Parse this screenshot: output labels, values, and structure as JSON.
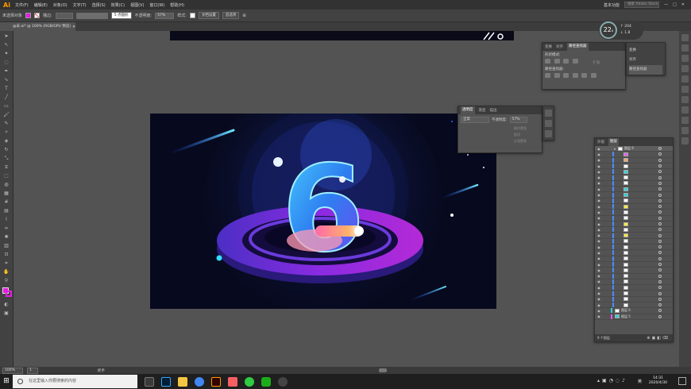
{
  "app": {
    "logo": "Ai",
    "menu": [
      "文件(F)",
      "编辑(E)",
      "对象(O)",
      "文字(T)",
      "选择(S)",
      "效果(C)",
      "视图(V)",
      "窗口(W)",
      "帮助(H)"
    ],
    "workspace": "基本功能",
    "search_placeholder": "搜索 Adobe Stock"
  },
  "control_bar": {
    "selection": "未选择对象",
    "stroke_label": "描边:",
    "stroke_style": "5 点圆形",
    "opacity_label": "不透明度:",
    "opacity": "57%",
    "style_label": "样式:",
    "doc_setup": "文档设置",
    "preferences": "首选项"
  },
  "document": {
    "tab": "@未.ai* @ 100% (RGB/GPU 预览)"
  },
  "pathfinder": {
    "tabs": [
      "变换",
      "对齐",
      "路径查找器"
    ],
    "shape_modes": "形状模式:",
    "pathfinders": "路径查找器:",
    "expand": "扩展"
  },
  "transparency": {
    "tabs": [
      "透明度",
      "渐变",
      "描边"
    ],
    "mode": "正常",
    "opacity_label": "不透明度:",
    "opacity": "57%",
    "opts": [
      "制作蒙版",
      "剪切",
      "反相蒙版"
    ]
  },
  "mini_dock": {
    "items": [
      "变换",
      "对齐",
      "路径查找器"
    ]
  },
  "layers": {
    "tabs": [
      "外观",
      "图层"
    ],
    "layer_top": "图层 9",
    "layer_bottom1": "图层 6",
    "layer_bottom2": "图层 5",
    "count": "9 个图层",
    "row_colors": [
      "#e05de8",
      "#f0a96a",
      "#ffffff",
      "#2fd4d6",
      "#ffffff",
      "#ffffff",
      "#2fd4d6",
      "#2fd4d6",
      "#ffffff",
      "#ffeb3b",
      "#ffffff",
      "#ffffff",
      "#ffeb3b",
      "#ffffff",
      "#ffeb3b",
      "#ffffff",
      "#ffffff",
      "#ffffff",
      "#ffffff",
      "#ffffff",
      "#ffffff",
      "#ffffff",
      "#ffffff",
      "#ffffff",
      "#ffffff",
      "#ffffff",
      "#ffffff",
      "#ffffff",
      "#ffffff",
      "#ffffff"
    ]
  },
  "recording": {
    "number": "22",
    "unit": "x",
    "up": "204",
    "down": "1.8"
  },
  "status": {
    "zoom": "100%",
    "page": "1",
    "tool": "抓手"
  },
  "taskbar": {
    "search": "在这里输入你要搜索的内容",
    "time": "14:31",
    "date": "2020/4/30",
    "ime": "英"
  },
  "artwork": {
    "digit": "6"
  }
}
